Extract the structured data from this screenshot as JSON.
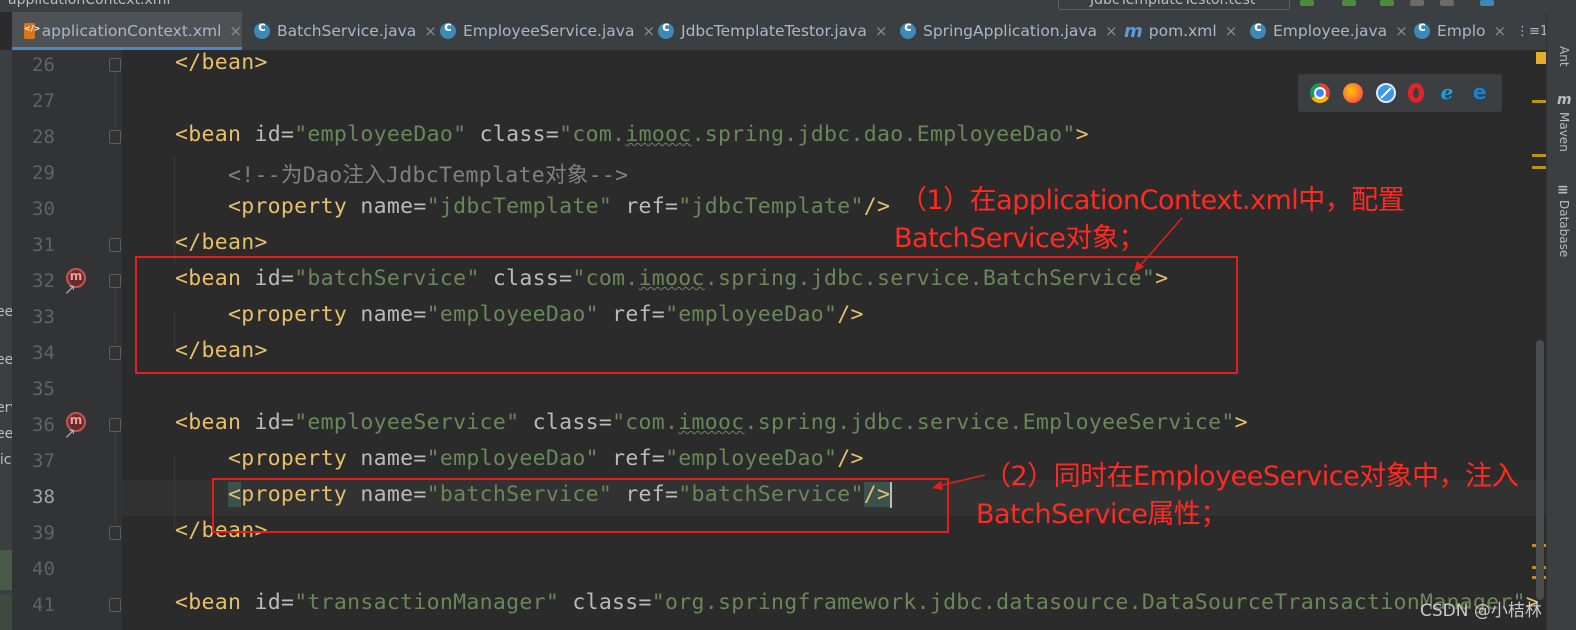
{
  "window": {
    "title_fragment": "applicationContext.xml",
    "run_config_fragment": "JdbcTemplateTestor.test"
  },
  "tabs": [
    {
      "label": "applicationContext.xml",
      "icon": "xml-file-icon",
      "active": true
    },
    {
      "label": "BatchService.java",
      "icon": "java-class-icon"
    },
    {
      "label": "EmployeeService.java",
      "icon": "java-class-icon"
    },
    {
      "label": "JdbcTemplateTestor.java",
      "icon": "java-class-icon"
    },
    {
      "label": "SpringApplication.java",
      "icon": "java-class-icon"
    },
    {
      "label": "pom.xml",
      "icon": "maven-icon"
    },
    {
      "label": "Employee.java",
      "icon": "java-class-icon"
    },
    {
      "label": "Emplo",
      "icon": "java-class-icon"
    }
  ],
  "tab_overflow": "⋮≡1",
  "tab_close": "×",
  "left_panel_fragments": [
    "ee",
    "ee",
    "erv",
    "ee",
    "lic"
  ],
  "line_numbers": [
    "26",
    "27",
    "28",
    "29",
    "30",
    "31",
    "32",
    "33",
    "34",
    "35",
    "36",
    "37",
    "38",
    "39",
    "40",
    "41"
  ],
  "code_lines": [
    {
      "n": "26",
      "text": "    </bean>"
    },
    {
      "n": "27",
      "text": ""
    },
    {
      "n": "28",
      "text": "    <bean id=\"employeeDao\" class=\"com.imooc.spring.jdbc.dao.EmployeeDao\">"
    },
    {
      "n": "29",
      "text": "        <!--为Dao注入JdbcTemplate对象-->"
    },
    {
      "n": "30",
      "text": "        <property name=\"jdbcTemplate\" ref=\"jdbcTemplate\"/>"
    },
    {
      "n": "31",
      "text": "    </bean>"
    },
    {
      "n": "32",
      "text": "    <bean id=\"batchService\" class=\"com.imooc.spring.jdbc.service.BatchService\">"
    },
    {
      "n": "33",
      "text": "        <property name=\"employeeDao\" ref=\"employeeDao\"/>"
    },
    {
      "n": "34",
      "text": "    </bean>"
    },
    {
      "n": "35",
      "text": ""
    },
    {
      "n": "36",
      "text": "    <bean id=\"employeeService\" class=\"com.imooc.spring.jdbc.service.EmployeeService\">"
    },
    {
      "n": "37",
      "text": "        <property name=\"employeeDao\" ref=\"employeeDao\"/>"
    },
    {
      "n": "38",
      "text": "        <property name=\"batchService\" ref=\"batchService\"/>"
    },
    {
      "n": "39",
      "text": "    </bean>"
    },
    {
      "n": "40",
      "text": ""
    },
    {
      "n": "41",
      "text": "    <bean id=\"transactionManager\" class=\"org.springframework.jdbc.datasource.DataSourceTransactionManager\">"
    }
  ],
  "annotations": {
    "note1_line1": "（1）在applicationContext.xml中，配置",
    "note1_line2": "BatchService对象；",
    "note2_line1": "（2）同时在EmployeeService对象中，注入",
    "note2_line2": "BatchService属性；",
    "color": "#ff2a22"
  },
  "browser_icons": [
    "chrome-icon",
    "firefox-icon",
    "safari-icon",
    "opera-icon",
    "internet-explorer-icon",
    "edge-icon"
  ],
  "right_tool_windows": [
    {
      "label": "Ant",
      "icon": "ant-icon"
    },
    {
      "label": "Maven",
      "icon": "maven-icon",
      "glyph": "m"
    },
    {
      "label": "Database",
      "icon": "database-icon",
      "glyph": "≡"
    }
  ],
  "watermark": "CSDN @小桔林",
  "colors": {
    "background": "#2b2b2b",
    "tag": "#e8bf6a",
    "attribute": "#bababa",
    "value": "#6a8759",
    "comment": "#808080",
    "annotation": "#e0201c"
  }
}
